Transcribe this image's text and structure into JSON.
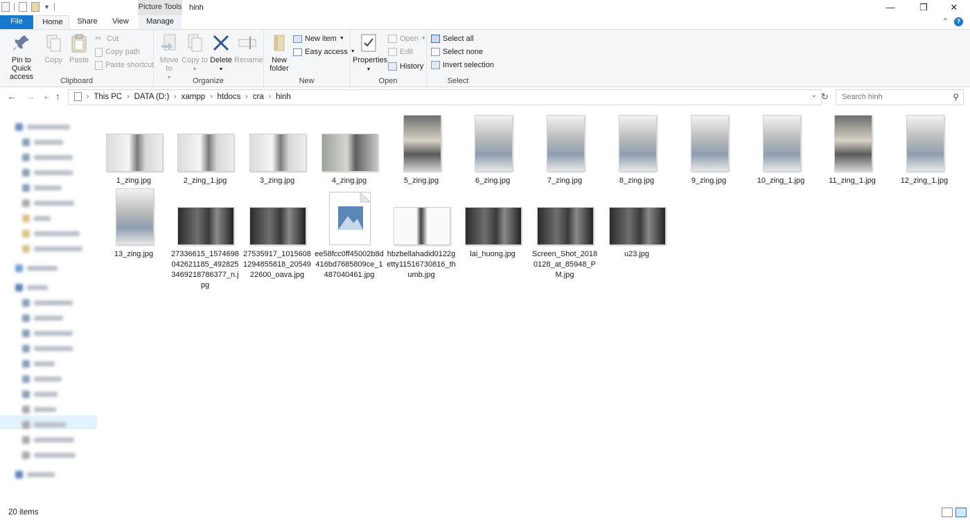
{
  "window": {
    "title": "hinh",
    "context_group": "Picture Tools"
  },
  "tabs": {
    "file": "File",
    "home": "Home",
    "share": "Share",
    "view": "View",
    "manage": "Manage"
  },
  "ribbon": {
    "clipboard": {
      "label": "Clipboard",
      "pin": "Pin to Quick access",
      "copy": "Copy",
      "paste": "Paste",
      "cut": "Cut",
      "copy_path": "Copy path",
      "paste_shortcut": "Paste shortcut"
    },
    "organize": {
      "label": "Organize",
      "move_to": "Move to",
      "copy_to": "Copy to",
      "delete": "Delete",
      "rename": "Rename"
    },
    "new": {
      "label": "New",
      "new_folder": "New folder",
      "new_item": "New item",
      "easy_access": "Easy access"
    },
    "open": {
      "label": "Open",
      "properties": "Properties",
      "open": "Open",
      "edit": "Edit",
      "history": "History"
    },
    "select": {
      "label": "Select",
      "select_all": "Select all",
      "select_none": "Select none",
      "invert": "Invert selection"
    }
  },
  "address": {
    "crumbs": [
      "This PC",
      "DATA (D:)",
      "xampp",
      "htdocs",
      "cra",
      "hinh"
    ],
    "search_placeholder": "Search hinh"
  },
  "files": [
    {
      "name": "1_zing.jpg",
      "kind": "landscape-light"
    },
    {
      "name": "2_zing_1.jpg",
      "kind": "landscape-light"
    },
    {
      "name": "3_zing.jpg",
      "kind": "landscape-light"
    },
    {
      "name": "4_zing.jpg",
      "kind": "landscape-mid"
    },
    {
      "name": "5_zing.jpg",
      "kind": "portrait-mid"
    },
    {
      "name": "6_zing.jpg",
      "kind": "portrait-light"
    },
    {
      "name": "7_zing.jpg",
      "kind": "portrait-light"
    },
    {
      "name": "8_zing.jpg",
      "kind": "portrait-light"
    },
    {
      "name": "9_zing.jpg",
      "kind": "portrait-light"
    },
    {
      "name": "10_zing_1.jpg",
      "kind": "portrait-light"
    },
    {
      "name": "11_zing_1.jpg",
      "kind": "portrait-mid"
    },
    {
      "name": "12_zing_1.jpg",
      "kind": "portrait-light"
    },
    {
      "name": "13_zing.jpg",
      "kind": "portrait-light"
    },
    {
      "name": "27336615_1574698042621185_4928253469218786377_n.jpg",
      "kind": "landscape-dark"
    },
    {
      "name": "27535917_10156081294855818_2054922600_oava.jpg",
      "kind": "landscape-dark"
    },
    {
      "name": "ee58fcc0ff45002b8d416bd7685809ce_1487040461.jpg",
      "kind": "generic"
    },
    {
      "name": "hbzbellahadid0122getty11516730816_thumb.jpg",
      "kind": "landscape-white"
    },
    {
      "name": "lai_huong.jpg",
      "kind": "landscape-dark"
    },
    {
      "name": "Screen_Shot_20180128_at_85948_PM.jpg",
      "kind": "landscape-dark"
    },
    {
      "name": "u23.jpg",
      "kind": "landscape-dark"
    }
  ],
  "status": {
    "count": "20 items"
  }
}
